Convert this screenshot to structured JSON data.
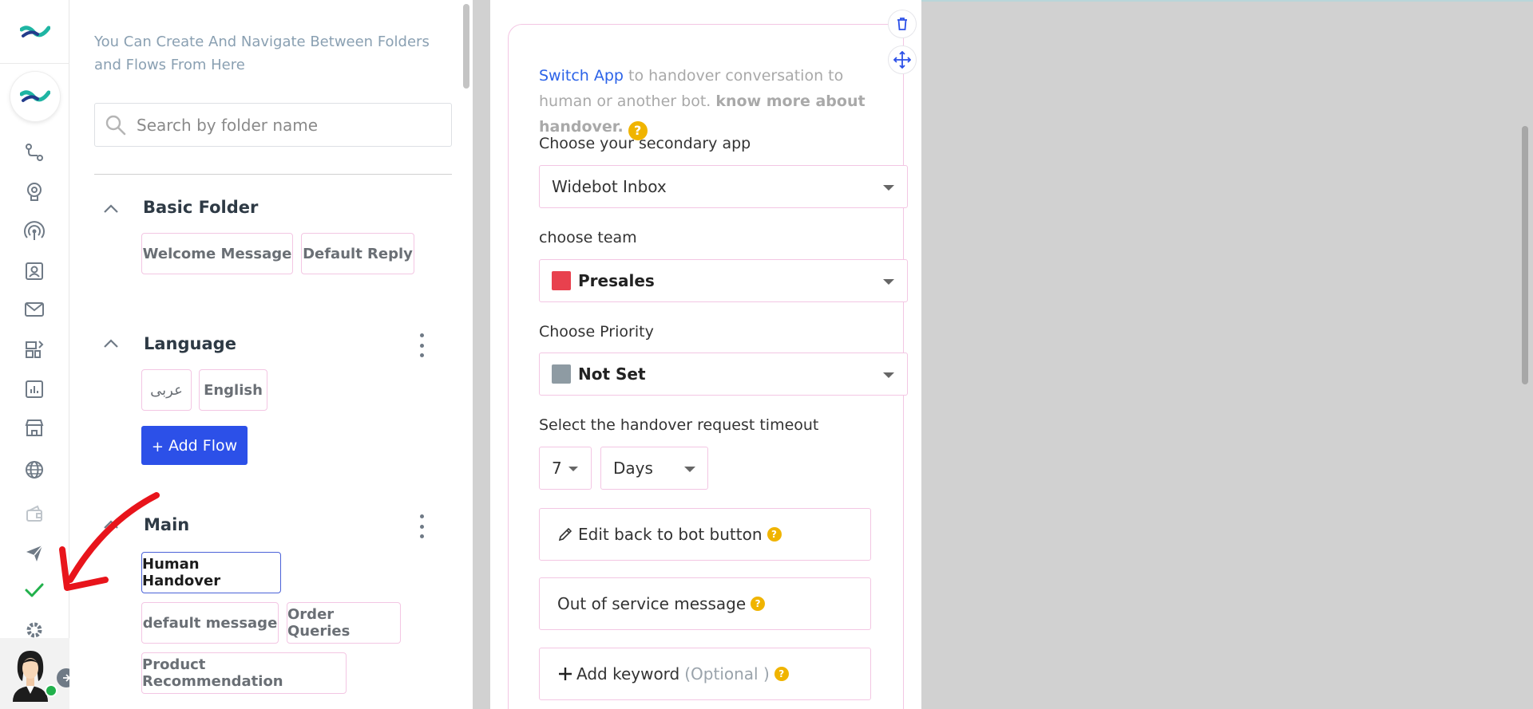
{
  "folder_panel": {
    "hint": "You Can Create And Navigate Between Folders and Flows From Here",
    "search_placeholder": "Search by folder name",
    "add_flow_label": "Add Flow",
    "folders": [
      {
        "title": "Basic Folder",
        "flows": [
          "Welcome Message",
          "Default Reply"
        ]
      },
      {
        "title": "Language",
        "flows": [
          "عربى",
          "English"
        ]
      },
      {
        "title": "Main",
        "flows": [
          "Human Handover",
          "default message",
          "Order Queries",
          "Product Recommendation"
        ],
        "active_flow": "Human Handover"
      }
    ]
  },
  "handover_card": {
    "intro_link": "Switch App",
    "intro_text": " to handover conversation to human or another bot. ",
    "intro_strong": "know more about handover.",
    "secondary_app_label": "Choose your secondary app",
    "secondary_app_value": "Widebot Inbox",
    "team_label": "choose team",
    "team_value": "Presales",
    "team_color": "#e8414e",
    "priority_label": "Choose Priority",
    "priority_value": "Not Set",
    "priority_color": "#8e9ba3",
    "timeout_label": "Select the handover request timeout",
    "timeout_value": "7",
    "timeout_unit": "Days",
    "edit_back_label": "Edit back to bot button",
    "out_of_service_label": "Out of service message",
    "add_keyword_label": "Add keyword",
    "add_keyword_optional": "(Optional )"
  },
  "icons": {
    "rail": [
      "flows-icon",
      "ai-brain-icon",
      "broadcast-icon",
      "contacts-icon",
      "inbox-icon",
      "apps-icon",
      "analytics-icon",
      "store-icon",
      "globe-icon",
      "wallet-icon",
      "send-icon",
      "check-icon",
      "settings-icon"
    ]
  },
  "colors": {
    "accent": "#2c50e8",
    "chip_border": "#f3c6e3",
    "help": "#f0b400",
    "arrow": "#e8141b"
  }
}
